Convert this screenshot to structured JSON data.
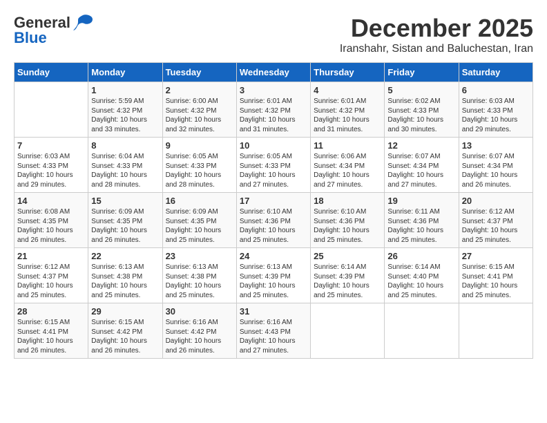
{
  "logo": {
    "general": "General",
    "blue": "Blue"
  },
  "title": {
    "month": "December 2025",
    "location": "Iranshahr, Sistan and Baluchestan, Iran"
  },
  "headers": [
    "Sunday",
    "Monday",
    "Tuesday",
    "Wednesday",
    "Thursday",
    "Friday",
    "Saturday"
  ],
  "weeks": [
    [
      {
        "day": "",
        "info": ""
      },
      {
        "day": "1",
        "info": "Sunrise: 5:59 AM\nSunset: 4:32 PM\nDaylight: 10 hours\nand 33 minutes."
      },
      {
        "day": "2",
        "info": "Sunrise: 6:00 AM\nSunset: 4:32 PM\nDaylight: 10 hours\nand 32 minutes."
      },
      {
        "day": "3",
        "info": "Sunrise: 6:01 AM\nSunset: 4:32 PM\nDaylight: 10 hours\nand 31 minutes."
      },
      {
        "day": "4",
        "info": "Sunrise: 6:01 AM\nSunset: 4:32 PM\nDaylight: 10 hours\nand 31 minutes."
      },
      {
        "day": "5",
        "info": "Sunrise: 6:02 AM\nSunset: 4:33 PM\nDaylight: 10 hours\nand 30 minutes."
      },
      {
        "day": "6",
        "info": "Sunrise: 6:03 AM\nSunset: 4:33 PM\nDaylight: 10 hours\nand 29 minutes."
      }
    ],
    [
      {
        "day": "7",
        "info": "Sunrise: 6:03 AM\nSunset: 4:33 PM\nDaylight: 10 hours\nand 29 minutes."
      },
      {
        "day": "8",
        "info": "Sunrise: 6:04 AM\nSunset: 4:33 PM\nDaylight: 10 hours\nand 28 minutes."
      },
      {
        "day": "9",
        "info": "Sunrise: 6:05 AM\nSunset: 4:33 PM\nDaylight: 10 hours\nand 28 minutes."
      },
      {
        "day": "10",
        "info": "Sunrise: 6:05 AM\nSunset: 4:33 PM\nDaylight: 10 hours\nand 27 minutes."
      },
      {
        "day": "11",
        "info": "Sunrise: 6:06 AM\nSunset: 4:34 PM\nDaylight: 10 hours\nand 27 minutes."
      },
      {
        "day": "12",
        "info": "Sunrise: 6:07 AM\nSunset: 4:34 PM\nDaylight: 10 hours\nand 27 minutes."
      },
      {
        "day": "13",
        "info": "Sunrise: 6:07 AM\nSunset: 4:34 PM\nDaylight: 10 hours\nand 26 minutes."
      }
    ],
    [
      {
        "day": "14",
        "info": "Sunrise: 6:08 AM\nSunset: 4:35 PM\nDaylight: 10 hours\nand 26 minutes."
      },
      {
        "day": "15",
        "info": "Sunrise: 6:09 AM\nSunset: 4:35 PM\nDaylight: 10 hours\nand 26 minutes."
      },
      {
        "day": "16",
        "info": "Sunrise: 6:09 AM\nSunset: 4:35 PM\nDaylight: 10 hours\nand 25 minutes."
      },
      {
        "day": "17",
        "info": "Sunrise: 6:10 AM\nSunset: 4:36 PM\nDaylight: 10 hours\nand 25 minutes."
      },
      {
        "day": "18",
        "info": "Sunrise: 6:10 AM\nSunset: 4:36 PM\nDaylight: 10 hours\nand 25 minutes."
      },
      {
        "day": "19",
        "info": "Sunrise: 6:11 AM\nSunset: 4:36 PM\nDaylight: 10 hours\nand 25 minutes."
      },
      {
        "day": "20",
        "info": "Sunrise: 6:12 AM\nSunset: 4:37 PM\nDaylight: 10 hours\nand 25 minutes."
      }
    ],
    [
      {
        "day": "21",
        "info": "Sunrise: 6:12 AM\nSunset: 4:37 PM\nDaylight: 10 hours\nand 25 minutes."
      },
      {
        "day": "22",
        "info": "Sunrise: 6:13 AM\nSunset: 4:38 PM\nDaylight: 10 hours\nand 25 minutes."
      },
      {
        "day": "23",
        "info": "Sunrise: 6:13 AM\nSunset: 4:38 PM\nDaylight: 10 hours\nand 25 minutes."
      },
      {
        "day": "24",
        "info": "Sunrise: 6:13 AM\nSunset: 4:39 PM\nDaylight: 10 hours\nand 25 minutes."
      },
      {
        "day": "25",
        "info": "Sunrise: 6:14 AM\nSunset: 4:39 PM\nDaylight: 10 hours\nand 25 minutes."
      },
      {
        "day": "26",
        "info": "Sunrise: 6:14 AM\nSunset: 4:40 PM\nDaylight: 10 hours\nand 25 minutes."
      },
      {
        "day": "27",
        "info": "Sunrise: 6:15 AM\nSunset: 4:41 PM\nDaylight: 10 hours\nand 25 minutes."
      }
    ],
    [
      {
        "day": "28",
        "info": "Sunrise: 6:15 AM\nSunset: 4:41 PM\nDaylight: 10 hours\nand 26 minutes."
      },
      {
        "day": "29",
        "info": "Sunrise: 6:15 AM\nSunset: 4:42 PM\nDaylight: 10 hours\nand 26 minutes."
      },
      {
        "day": "30",
        "info": "Sunrise: 6:16 AM\nSunset: 4:42 PM\nDaylight: 10 hours\nand 26 minutes."
      },
      {
        "day": "31",
        "info": "Sunrise: 6:16 AM\nSunset: 4:43 PM\nDaylight: 10 hours\nand 27 minutes."
      },
      {
        "day": "",
        "info": ""
      },
      {
        "day": "",
        "info": ""
      },
      {
        "day": "",
        "info": ""
      }
    ]
  ]
}
